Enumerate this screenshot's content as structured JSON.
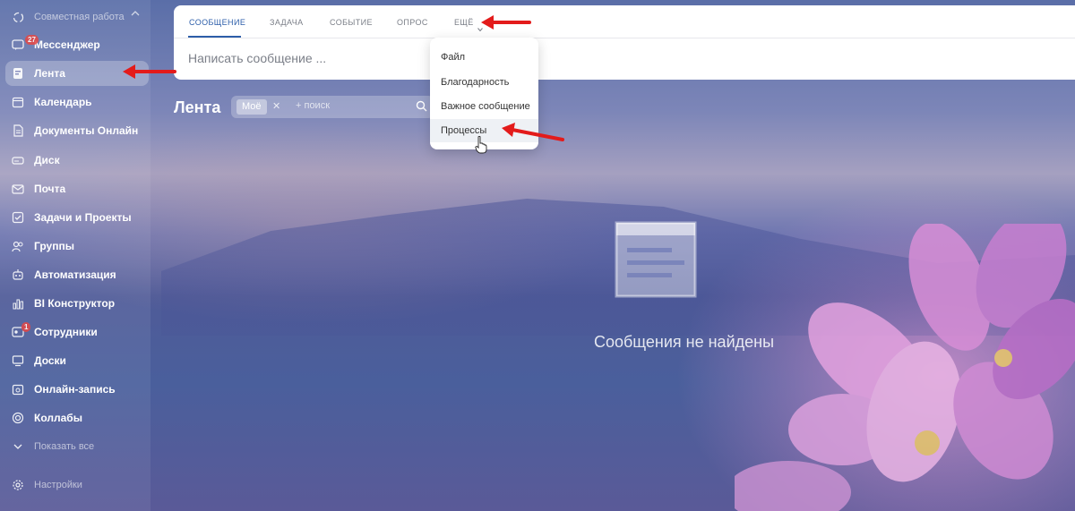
{
  "sidebar": {
    "header": "Совместная работа",
    "items": [
      {
        "label": "Мессенджер",
        "icon": "chat-icon",
        "badge": "27"
      },
      {
        "label": "Лента",
        "icon": "feed-icon",
        "active": true
      },
      {
        "label": "Календарь",
        "icon": "calendar-icon"
      },
      {
        "label": "Документы Онлайн",
        "icon": "document-icon"
      },
      {
        "label": "Диск",
        "icon": "disk-icon"
      },
      {
        "label": "Почта",
        "icon": "mail-icon"
      },
      {
        "label": "Задачи и Проекты",
        "icon": "checkbox-icon"
      },
      {
        "label": "Группы",
        "icon": "group-icon"
      },
      {
        "label": "Автоматизация",
        "icon": "automation-icon"
      },
      {
        "label": "BI Конструктор",
        "icon": "bar-chart-icon"
      },
      {
        "label": "Сотрудники",
        "icon": "employees-icon",
        "badge": "1"
      },
      {
        "label": "Доски",
        "icon": "board-icon"
      },
      {
        "label": "Онлайн-запись",
        "icon": "booking-icon"
      },
      {
        "label": "Коллабы",
        "icon": "collab-icon"
      }
    ],
    "show_all": "Показать все",
    "settings": "Настройки"
  },
  "post_panel": {
    "tabs": [
      "СООБЩЕНИЕ",
      "ЗАДАЧА",
      "СОБЫТИЕ",
      "ОПРОС",
      "ЕЩЁ"
    ],
    "active_tab": "СООБЩЕНИЕ",
    "compose_placeholder": "Написать сообщение ..."
  },
  "page": {
    "title": "Лента",
    "filter_chip": "Моё",
    "search_placeholder": "поиск"
  },
  "more_menu": {
    "items": [
      "Файл",
      "Благодарность",
      "Важное сообщение",
      "Процессы"
    ],
    "hovered": "Процессы"
  },
  "empty_state": {
    "message": "Сообщения не найдены"
  },
  "colors": {
    "accent": "#2d5ea9",
    "annotation_arrow": "#e31b1b"
  }
}
